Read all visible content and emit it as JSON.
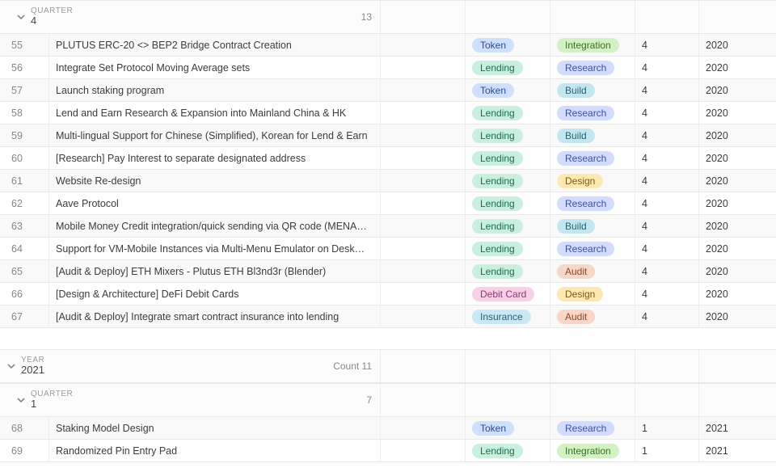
{
  "groups": [
    {
      "level": 1,
      "label_small": "QUARTER",
      "label_value": "4",
      "count_label": "13",
      "rows": [
        {
          "num": "55",
          "title": "PLUTUS ERC-20 <> BEP2 Bridge Contract Creation",
          "type": "Token",
          "stage": "Integration",
          "q": "4",
          "y": "2020"
        },
        {
          "num": "56",
          "title": "Integrate Set Protocol Moving Average sets",
          "type": "Lending",
          "stage": "Research",
          "q": "4",
          "y": "2020"
        },
        {
          "num": "57",
          "title": "Launch staking program",
          "type": "Token",
          "stage": "Build",
          "q": "4",
          "y": "2020"
        },
        {
          "num": "58",
          "title": "Lend and Earn Research & Expansion into Mainland China & HK",
          "type": "Lending",
          "stage": "Research",
          "q": "4",
          "y": "2020"
        },
        {
          "num": "59",
          "title": "Multi-lingual Support for Chinese (Simplified), Korean for Lend & Earn",
          "type": "Lending",
          "stage": "Build",
          "q": "4",
          "y": "2020"
        },
        {
          "num": "60",
          "title": "[Research] Pay Interest to separate designated address",
          "type": "Lending",
          "stage": "Research",
          "q": "4",
          "y": "2020"
        },
        {
          "num": "61",
          "title": "Website Re-design",
          "type": "Lending",
          "stage": "Design",
          "q": "4",
          "y": "2020"
        },
        {
          "num": "62",
          "title": "Aave Protocol",
          "type": "Lending",
          "stage": "Research",
          "q": "4",
          "y": "2020"
        },
        {
          "num": "63",
          "title": "Mobile Money Credit integration/quick sending via QR code (MENA…",
          "type": "Lending",
          "stage": "Build",
          "q": "4",
          "y": "2020"
        },
        {
          "num": "64",
          "title": "Support for VM-Mobile Instances via Multi-Menu Emulator on Desk…",
          "type": "Lending",
          "stage": "Research",
          "q": "4",
          "y": "2020"
        },
        {
          "num": "65",
          "title": "[Audit & Deploy] ETH Mixers - Plutus ETH Bl3nd3r (Blender)",
          "type": "Lending",
          "stage": "Audit",
          "q": "4",
          "y": "2020"
        },
        {
          "num": "66",
          "title": "[Design & Architecture] DeFi Debit Cards",
          "type": "Debit Card",
          "stage": "Design",
          "q": "4",
          "y": "2020"
        },
        {
          "num": "67",
          "title": "[Audit & Deploy] Integrate smart contract insurance into lending",
          "type": "Insurance",
          "stage": "Audit",
          "q": "4",
          "y": "2020"
        }
      ]
    },
    {
      "level": 0,
      "label_small": "YEAR",
      "label_value": "2021",
      "count_label": "Count 11",
      "rows": []
    },
    {
      "level": 1,
      "label_small": "QUARTER",
      "label_value": "1",
      "count_label": "7",
      "rows": [
        {
          "num": "68",
          "title": "Staking Model Design",
          "type": "Token",
          "stage": "Research",
          "q": "1",
          "y": "2021"
        },
        {
          "num": "69",
          "title": "Randomized Pin Entry Pad",
          "type": "Lending",
          "stage": "Integration",
          "q": "1",
          "y": "2021"
        }
      ]
    }
  ],
  "tag_classes": {
    "Token": "c-token",
    "Lending": "c-lending",
    "Debit Card": "c-debitcard",
    "Insurance": "c-insurance",
    "Integration": "c-integration",
    "Research": "c-research",
    "Build": "c-build",
    "Design": "c-design",
    "Audit": "c-audit"
  }
}
